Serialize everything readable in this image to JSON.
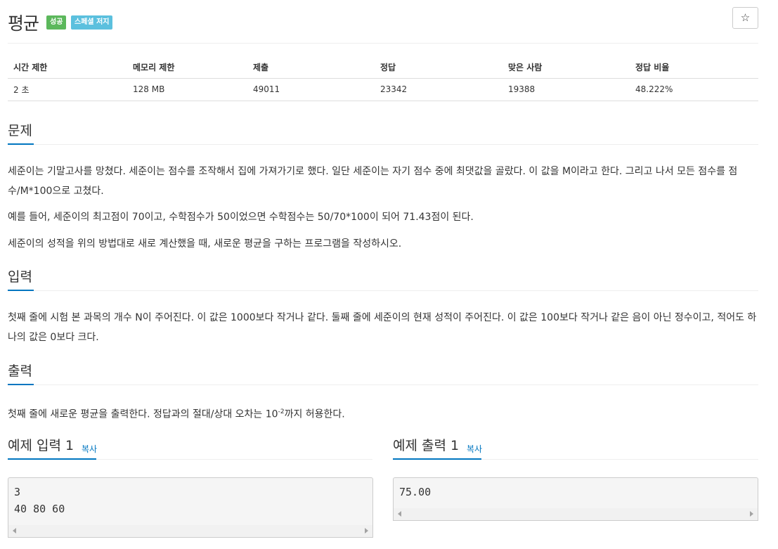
{
  "problem": {
    "title": "평균",
    "badges": [
      "성공",
      "스페셜 저지"
    ],
    "star_icon": "☆"
  },
  "info_table": {
    "headers": [
      "시간 제한",
      "메모리 제한",
      "제출",
      "정답",
      "맞은 사람",
      "정답 비율"
    ],
    "values": [
      "2 초",
      "128 MB",
      "49011",
      "23342",
      "19388",
      "48.222%"
    ]
  },
  "sections": {
    "description": {
      "title": "문제",
      "paragraphs": [
        "세준이는 기말고사를 망쳤다. 세준이는 점수를 조작해서 집에 가져가기로 했다. 일단 세준이는 자기 점수 중에 최댓값을 골랐다. 이 값을 M이라고 한다. 그리고 나서 모든 점수를 점수/M*100으로 고쳤다.",
        "예를 들어, 세준이의 최고점이 70이고, 수학점수가 50이었으면 수학점수는 50/70*100이 되어 71.43점이 된다.",
        "세준이의 성적을 위의 방법대로 새로 계산했을 때, 새로운 평균을 구하는 프로그램을 작성하시오."
      ]
    },
    "input": {
      "title": "입력",
      "paragraphs": [
        "첫째 줄에 시험 본 과목의 개수 N이 주어진다. 이 값은 1000보다 작거나 같다. 둘째 줄에 세준이의 현재 성적이 주어진다. 이 값은 100보다 작거나 같은 음이 아닌 정수이고, 적어도 하나의 값은 0보다 크다."
      ]
    },
    "output": {
      "title": "출력",
      "text_before": "첫째 줄에 새로운 평균을 출력한다. 정답과의 절대/상대 오차는 10",
      "superscript": "-2",
      "text_after": "까지 허용한다."
    }
  },
  "samples": {
    "input_title": "예제 입력 1",
    "output_title": "예제 출력 1",
    "copy_label": "복사",
    "input_lines": [
      "3",
      "40 80 60"
    ],
    "output_lines": [
      "75.00"
    ]
  }
}
